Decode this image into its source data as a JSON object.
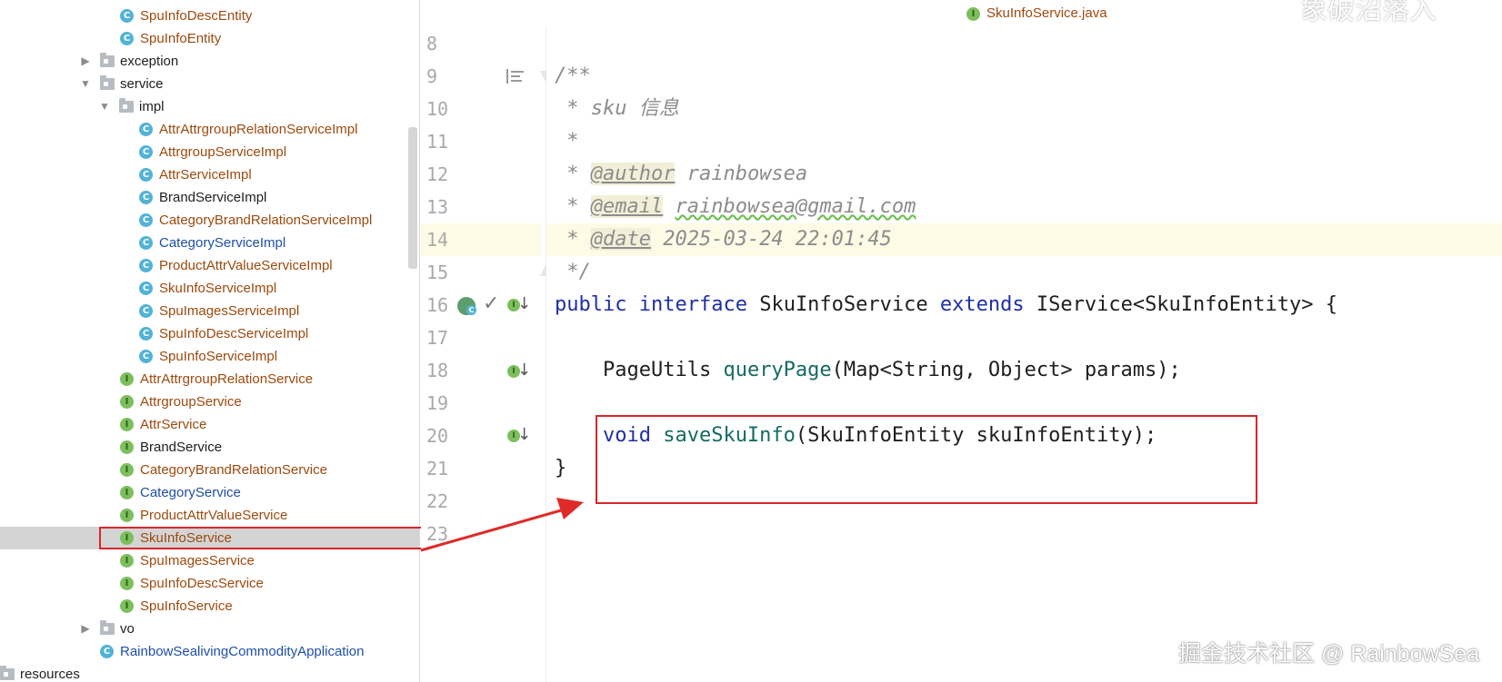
{
  "tree": {
    "items": [
      {
        "label": "SpuInfoDescEntity",
        "icon": "class-icon",
        "color": "brown"
      },
      {
        "label": "SpuInfoEntity",
        "icon": "class-icon",
        "color": "brown"
      },
      {
        "label": "exception",
        "icon": "package-icon",
        "color": "black",
        "arrow": "▶"
      },
      {
        "label": "service",
        "icon": "package-icon",
        "color": "black",
        "arrow": "▼"
      },
      {
        "label": "impl",
        "icon": "package-icon",
        "color": "black",
        "arrow": "▼"
      },
      {
        "label": "AttrAttrgroupRelationServiceImpl",
        "icon": "class-icon",
        "color": "brown"
      },
      {
        "label": "AttrgroupServiceImpl",
        "icon": "class-icon",
        "color": "brown"
      },
      {
        "label": "AttrServiceImpl",
        "icon": "class-icon",
        "color": "brown"
      },
      {
        "label": "BrandServiceImpl",
        "icon": "class-icon",
        "color": "black"
      },
      {
        "label": "CategoryBrandRelationServiceImpl",
        "icon": "class-icon",
        "color": "brown"
      },
      {
        "label": "CategoryServiceImpl",
        "icon": "class-icon",
        "color": "blue"
      },
      {
        "label": "ProductAttrValueServiceImpl",
        "icon": "class-icon",
        "color": "brown"
      },
      {
        "label": "SkuInfoServiceImpl",
        "icon": "class-icon",
        "color": "brown"
      },
      {
        "label": "SpuImagesServiceImpl",
        "icon": "class-icon",
        "color": "brown"
      },
      {
        "label": "SpuInfoDescServiceImpl",
        "icon": "class-icon",
        "color": "brown"
      },
      {
        "label": "SpuInfoServiceImpl",
        "icon": "class-icon",
        "color": "brown"
      },
      {
        "label": "AttrAttrgroupRelationService",
        "icon": "interface-icon",
        "color": "brown"
      },
      {
        "label": "AttrgroupService",
        "icon": "interface-icon",
        "color": "brown"
      },
      {
        "label": "AttrService",
        "icon": "interface-icon",
        "color": "brown"
      },
      {
        "label": "BrandService",
        "icon": "interface-icon",
        "color": "black"
      },
      {
        "label": "CategoryBrandRelationService",
        "icon": "interface-icon",
        "color": "brown"
      },
      {
        "label": "CategoryService",
        "icon": "interface-icon",
        "color": "blue"
      },
      {
        "label": "ProductAttrValueService",
        "icon": "interface-icon",
        "color": "brown"
      },
      {
        "label": "SkuInfoService",
        "icon": "interface-icon",
        "color": "brown",
        "selected": true
      },
      {
        "label": "SpuImagesService",
        "icon": "interface-icon",
        "color": "brown"
      },
      {
        "label": "SpuInfoDescService",
        "icon": "interface-icon",
        "color": "brown"
      },
      {
        "label": "SpuInfoService",
        "icon": "interface-icon",
        "color": "brown"
      },
      {
        "label": "vo",
        "icon": "package-icon",
        "color": "black",
        "arrow": "▶"
      },
      {
        "label": "RainbowSealivingCommodityApplication",
        "icon": "spring-app-icon",
        "color": "blue"
      },
      {
        "label": "resources",
        "icon": "folder-icon",
        "color": "black"
      }
    ]
  },
  "editor": {
    "tab_label": "SkuInfoService.java",
    "badge_class": "C",
    "badge_interface": "I",
    "line_numbers": [
      "8",
      "9",
      "10",
      "11",
      "12",
      "13",
      "14",
      "15",
      "16",
      "17",
      "18",
      "19",
      "20",
      "21",
      "22",
      "23"
    ],
    "code": {
      "l9": "/**",
      "l10": " * sku 信息",
      "l11": " *",
      "l12_prefix": " * ",
      "l12_tag": "@author",
      "l12_text": " rainbowsea",
      "l13_prefix": " * ",
      "l13_tag": "@email",
      "l13_text": "rainbowsea@gmail.com",
      "l14_prefix": " * ",
      "l14_tag": "@date",
      "l14_text": " 2025-03-24 22:01:45",
      "l15": " */",
      "l16_kw1": "public",
      "l16_kw2": "interface",
      "l16_name": "SkuInfoService",
      "l16_kw3": "extends",
      "l16_rest": "IService<SkuInfoEntity> {",
      "l18_type": "PageUtils",
      "l18_fn": "queryPage",
      "l18_args": "(Map<String, Object> params);",
      "l20_kw": "void",
      "l20_fn": "saveSkuInfo",
      "l20_args": "(SkuInfoEntity skuInfoEntity);",
      "l21": "}"
    }
  },
  "watermark": "掘金技术社区 @ RainbowSea",
  "top_right_fragment": "象破沼落入",
  "colors": {
    "highlight_red": "#d8262c",
    "keyword_blue": "#1f2fa6",
    "method_teal": "#146b62",
    "comment_gray": "#8c8c8c"
  }
}
